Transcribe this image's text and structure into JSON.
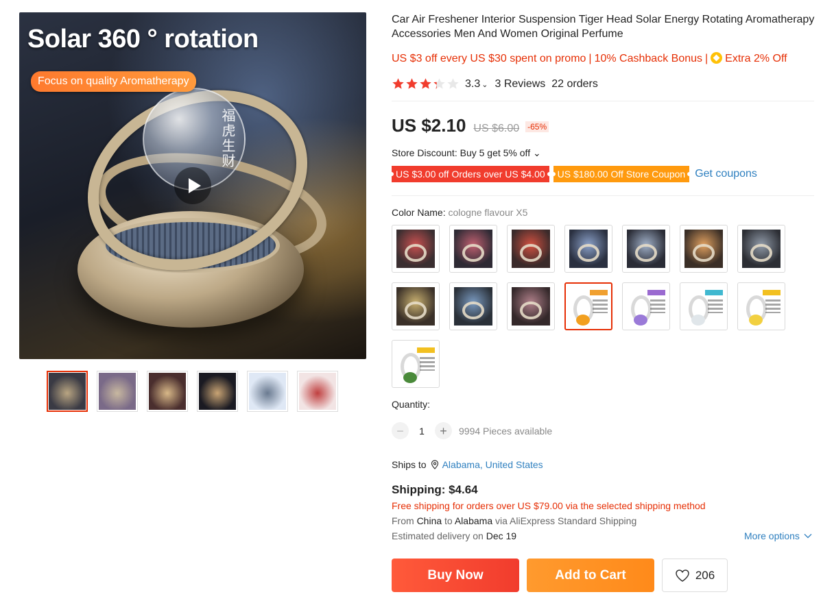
{
  "gallery": {
    "main_image": {
      "headline": "Solar 360 ° rotation",
      "pill": "Focus on quality Aromatherapy",
      "glyphs": "福虎生财"
    },
    "thumbnails": [
      {
        "label": "thumbnail-1",
        "colors": [
          "#3a3a44",
          "#b9a582"
        ]
      },
      {
        "label": "thumbnail-2",
        "colors": [
          "#7a6a88",
          "#c8b8a0"
        ]
      },
      {
        "label": "thumbnail-3",
        "colors": [
          "#4a2e2e",
          "#d8b888"
        ]
      },
      {
        "label": "thumbnail-4",
        "colors": [
          "#1a1a22",
          "#c9a474"
        ]
      },
      {
        "label": "thumbnail-5",
        "colors": [
          "#dfe8f5",
          "#6a7a90"
        ]
      },
      {
        "label": "thumbnail-6",
        "colors": [
          "#f2e4e4",
          "#c04040"
        ]
      }
    ]
  },
  "product": {
    "title": "Car Air Freshener Interior Suspension Tiger Head Solar Energy Rotating Aromatherapy Accessories Men And Women Original Perfume",
    "promo": {
      "item1": "US $3 off every US $30 spent on promo",
      "item2": "10% Cashback Bonus",
      "item3": "Extra 2% Off",
      "separator": "|"
    },
    "rating": {
      "value": 3.3,
      "value_text": "3.3",
      "chevron": "⌄",
      "reviews": "3 Reviews",
      "orders": "22 orders"
    },
    "price": {
      "current": "US $2.10",
      "original": "US $6.00",
      "discount": "-65%"
    },
    "store_discount": "Store Discount: Buy 5 get 5% off ⌄",
    "coupons": {
      "coupon1": "US $3.00 off Orders over US $4.00",
      "coupon2": "US $180.00 Off Store Coupon",
      "get_coupons": "Get coupons"
    },
    "color": {
      "label": "Color Name: ",
      "selected": "cologne flavour X5",
      "swatches": [
        {
          "kind": "photo",
          "bg": "#3a2e30",
          "accent": "#c85050"
        },
        {
          "kind": "photo",
          "bg": "#2e2a34",
          "accent": "#c06070"
        },
        {
          "kind": "photo",
          "bg": "#3a2a2a",
          "accent": "#d05040"
        },
        {
          "kind": "photo",
          "bg": "#2a3040",
          "accent": "#8aa0c8"
        },
        {
          "kind": "photo",
          "bg": "#2a2c36",
          "accent": "#a0b0c8"
        },
        {
          "kind": "photo",
          "bg": "#3a2e26",
          "accent": "#e0a060"
        },
        {
          "kind": "photo",
          "bg": "#2c2e34",
          "accent": "#909aa8"
        },
        {
          "kind": "photo",
          "bg": "#3a3028",
          "accent": "#c8b070"
        },
        {
          "kind": "photo",
          "bg": "#2a3038",
          "accent": "#7a9ac0"
        },
        {
          "kind": "photo",
          "bg": "#34282a",
          "accent": "#b0808a"
        },
        {
          "kind": "white",
          "tag": "#f0a030",
          "flower": "#f2a020",
          "selected": true
        },
        {
          "kind": "white",
          "tag": "#9a6ad0",
          "flower": "#9a7ad8"
        },
        {
          "kind": "white",
          "tag": "#40b8d0",
          "flower": "#e0e6ea"
        },
        {
          "kind": "white",
          "tag": "#f2c020",
          "flower": "#f2d040"
        },
        {
          "kind": "white",
          "tag": "#f2c020",
          "flower": "#4a8a3a"
        }
      ]
    },
    "quantity": {
      "label": "Quantity:",
      "minus": "−",
      "value": "1",
      "plus": "+",
      "available": "9994 Pieces available"
    },
    "shipping": {
      "ships_to_label": "Ships to",
      "ships_to_location": "Alabama, United States",
      "cost": "Shipping: $4.64",
      "free_shipping": "Free shipping for orders over US $79.00 via the selected shipping method",
      "from_prefix": "From ",
      "from_country": "China",
      "to_word": " to ",
      "to_region": "Alabama",
      "via": " via AliExpress Standard Shipping",
      "est_prefix": "Estimated delivery on ",
      "est_date": "Dec 19",
      "more_options": "More options"
    },
    "actions": {
      "buy_now": "Buy Now",
      "add_to_cart": "Add to Cart",
      "wishlist_count": "206"
    }
  },
  "colors": {
    "accent_red": "#e62e04",
    "link_blue": "#2e7fbf",
    "coupon_red": "#f13c2d",
    "coupon_orange": "#ff9a0e",
    "star_red": "#f13c2d"
  }
}
